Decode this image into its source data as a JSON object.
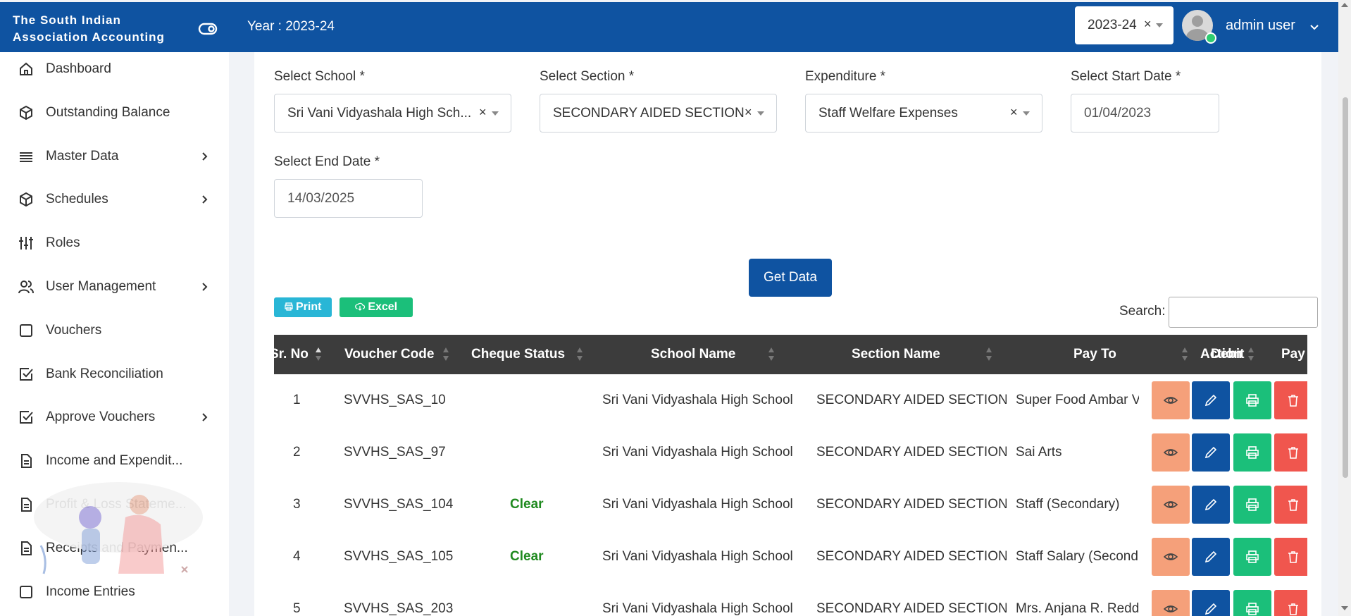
{
  "header": {
    "brand": "The South Indian Association Accounting",
    "year_label": "Year : 2023-24",
    "year_select": "2023-24",
    "user_name": "admin user"
  },
  "sidebar": {
    "items": [
      {
        "label": "Dashboard",
        "icon": "home-icon",
        "has_children": false
      },
      {
        "label": "Outstanding Balance",
        "icon": "cube-icon",
        "has_children": false
      },
      {
        "label": "Master Data",
        "icon": "list-icon",
        "has_children": true
      },
      {
        "label": "Schedules",
        "icon": "cube-icon",
        "has_children": true
      },
      {
        "label": "Roles",
        "icon": "sliders-icon",
        "has_children": false
      },
      {
        "label": "User Management",
        "icon": "users-icon",
        "has_children": true
      },
      {
        "label": "Vouchers",
        "icon": "square-icon",
        "has_children": false
      },
      {
        "label": "Bank Reconciliation",
        "icon": "check-square-icon",
        "has_children": false
      },
      {
        "label": "Approve Vouchers",
        "icon": "check-square-icon",
        "has_children": true
      },
      {
        "label": "Income and Expendit...",
        "icon": "file-icon",
        "has_children": false
      },
      {
        "label": "Profit & Loss Stateme...",
        "icon": "file-icon",
        "has_children": false
      },
      {
        "label": "Receipts and Paymen...",
        "icon": "file-icon",
        "has_children": false
      },
      {
        "label": "Income Entries",
        "icon": "square-icon",
        "has_children": false
      }
    ]
  },
  "filters": {
    "school": {
      "label": "Select School *",
      "value": "Sri Vani Vidyashala High Sch..."
    },
    "section": {
      "label": "Select Section *",
      "value": "SECONDARY AIDED SECTION"
    },
    "expenditure": {
      "label": "Expenditure *",
      "value": "Staff Welfare Expenses"
    },
    "start_date": {
      "label": "Select Start Date *",
      "value": "01/04/2023"
    },
    "end_date": {
      "label": "Select End Date *",
      "value": "14/03/2025"
    },
    "get_data": "Get Data"
  },
  "toolbar": {
    "print": "Print",
    "excel": "Excel",
    "search_label": "Search:"
  },
  "table": {
    "headers": [
      "Sr. No",
      "Voucher Code",
      "Cheque Status",
      "School Name",
      "Section Name",
      "Pay To",
      "Action",
      "Debit",
      "Pay"
    ],
    "rows": [
      {
        "sr": "1",
        "code": "SVVHS_SAS_10",
        "cheque": "",
        "school": "Sri Vani Vidyashala High School",
        "section": "SECONDARY AIDED SECTION",
        "pay_to": "Super Food Ambar V"
      },
      {
        "sr": "2",
        "code": "SVVHS_SAS_97",
        "cheque": "",
        "school": "Sri Vani Vidyashala High School",
        "section": "SECONDARY AIDED SECTION",
        "pay_to": "Sai Arts"
      },
      {
        "sr": "3",
        "code": "SVVHS_SAS_104",
        "cheque": "Clear",
        "school": "Sri Vani Vidyashala High School",
        "section": "SECONDARY AIDED SECTION",
        "pay_to": "Staff (Secondary)"
      },
      {
        "sr": "4",
        "code": "SVVHS_SAS_105",
        "cheque": "Clear",
        "school": "Sri Vani Vidyashala High School",
        "section": "SECONDARY AIDED SECTION",
        "pay_to": "Staff Salary (Second"
      },
      {
        "sr": "5",
        "code": "SVVHS_SAS_203",
        "cheque": "",
        "school": "Sri Vani Vidyashala High School",
        "section": "SECONDARY AIDED SECTION",
        "pay_to": "Mrs. Anjana R. Redd"
      }
    ]
  },
  "colors": {
    "primary": "#0f53a1",
    "view": "#f5a07a",
    "print": "#1bbf7a",
    "delete": "#f0564e",
    "clear_status": "#1f8a1f"
  }
}
